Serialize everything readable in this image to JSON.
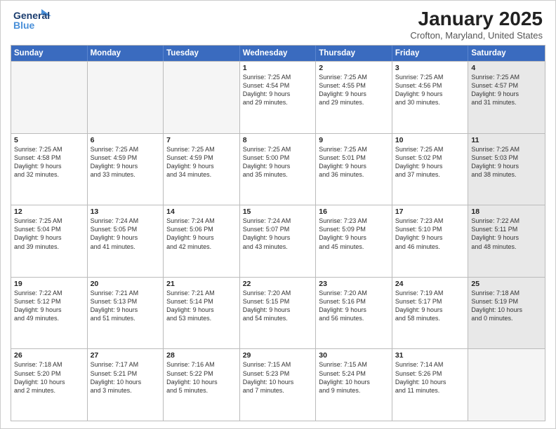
{
  "header": {
    "logo_line1": "General",
    "logo_line2": "Blue",
    "title": "January 2025",
    "subtitle": "Crofton, Maryland, United States"
  },
  "days_of_week": [
    "Sunday",
    "Monday",
    "Tuesday",
    "Wednesday",
    "Thursday",
    "Friday",
    "Saturday"
  ],
  "weeks": [
    [
      {
        "day": "",
        "info": "",
        "empty": true
      },
      {
        "day": "",
        "info": "",
        "empty": true
      },
      {
        "day": "",
        "info": "",
        "empty": true
      },
      {
        "day": "1",
        "info": "Sunrise: 7:25 AM\nSunset: 4:54 PM\nDaylight: 9 hours\nand 29 minutes."
      },
      {
        "day": "2",
        "info": "Sunrise: 7:25 AM\nSunset: 4:55 PM\nDaylight: 9 hours\nand 29 minutes."
      },
      {
        "day": "3",
        "info": "Sunrise: 7:25 AM\nSunset: 4:56 PM\nDaylight: 9 hours\nand 30 minutes."
      },
      {
        "day": "4",
        "info": "Sunrise: 7:25 AM\nSunset: 4:57 PM\nDaylight: 9 hours\nand 31 minutes.",
        "shaded": true
      }
    ],
    [
      {
        "day": "5",
        "info": "Sunrise: 7:25 AM\nSunset: 4:58 PM\nDaylight: 9 hours\nand 32 minutes."
      },
      {
        "day": "6",
        "info": "Sunrise: 7:25 AM\nSunset: 4:59 PM\nDaylight: 9 hours\nand 33 minutes."
      },
      {
        "day": "7",
        "info": "Sunrise: 7:25 AM\nSunset: 4:59 PM\nDaylight: 9 hours\nand 34 minutes."
      },
      {
        "day": "8",
        "info": "Sunrise: 7:25 AM\nSunset: 5:00 PM\nDaylight: 9 hours\nand 35 minutes."
      },
      {
        "day": "9",
        "info": "Sunrise: 7:25 AM\nSunset: 5:01 PM\nDaylight: 9 hours\nand 36 minutes."
      },
      {
        "day": "10",
        "info": "Sunrise: 7:25 AM\nSunset: 5:02 PM\nDaylight: 9 hours\nand 37 minutes."
      },
      {
        "day": "11",
        "info": "Sunrise: 7:25 AM\nSunset: 5:03 PM\nDaylight: 9 hours\nand 38 minutes.",
        "shaded": true
      }
    ],
    [
      {
        "day": "12",
        "info": "Sunrise: 7:25 AM\nSunset: 5:04 PM\nDaylight: 9 hours\nand 39 minutes."
      },
      {
        "day": "13",
        "info": "Sunrise: 7:24 AM\nSunset: 5:05 PM\nDaylight: 9 hours\nand 41 minutes."
      },
      {
        "day": "14",
        "info": "Sunrise: 7:24 AM\nSunset: 5:06 PM\nDaylight: 9 hours\nand 42 minutes."
      },
      {
        "day": "15",
        "info": "Sunrise: 7:24 AM\nSunset: 5:07 PM\nDaylight: 9 hours\nand 43 minutes."
      },
      {
        "day": "16",
        "info": "Sunrise: 7:23 AM\nSunset: 5:09 PM\nDaylight: 9 hours\nand 45 minutes."
      },
      {
        "day": "17",
        "info": "Sunrise: 7:23 AM\nSunset: 5:10 PM\nDaylight: 9 hours\nand 46 minutes."
      },
      {
        "day": "18",
        "info": "Sunrise: 7:22 AM\nSunset: 5:11 PM\nDaylight: 9 hours\nand 48 minutes.",
        "shaded": true
      }
    ],
    [
      {
        "day": "19",
        "info": "Sunrise: 7:22 AM\nSunset: 5:12 PM\nDaylight: 9 hours\nand 49 minutes."
      },
      {
        "day": "20",
        "info": "Sunrise: 7:21 AM\nSunset: 5:13 PM\nDaylight: 9 hours\nand 51 minutes."
      },
      {
        "day": "21",
        "info": "Sunrise: 7:21 AM\nSunset: 5:14 PM\nDaylight: 9 hours\nand 53 minutes."
      },
      {
        "day": "22",
        "info": "Sunrise: 7:20 AM\nSunset: 5:15 PM\nDaylight: 9 hours\nand 54 minutes."
      },
      {
        "day": "23",
        "info": "Sunrise: 7:20 AM\nSunset: 5:16 PM\nDaylight: 9 hours\nand 56 minutes."
      },
      {
        "day": "24",
        "info": "Sunrise: 7:19 AM\nSunset: 5:17 PM\nDaylight: 9 hours\nand 58 minutes."
      },
      {
        "day": "25",
        "info": "Sunrise: 7:18 AM\nSunset: 5:19 PM\nDaylight: 10 hours\nand 0 minutes.",
        "shaded": true
      }
    ],
    [
      {
        "day": "26",
        "info": "Sunrise: 7:18 AM\nSunset: 5:20 PM\nDaylight: 10 hours\nand 2 minutes."
      },
      {
        "day": "27",
        "info": "Sunrise: 7:17 AM\nSunset: 5:21 PM\nDaylight: 10 hours\nand 3 minutes."
      },
      {
        "day": "28",
        "info": "Sunrise: 7:16 AM\nSunset: 5:22 PM\nDaylight: 10 hours\nand 5 minutes."
      },
      {
        "day": "29",
        "info": "Sunrise: 7:15 AM\nSunset: 5:23 PM\nDaylight: 10 hours\nand 7 minutes."
      },
      {
        "day": "30",
        "info": "Sunrise: 7:15 AM\nSunset: 5:24 PM\nDaylight: 10 hours\nand 9 minutes."
      },
      {
        "day": "31",
        "info": "Sunrise: 7:14 AM\nSunset: 5:26 PM\nDaylight: 10 hours\nand 11 minutes."
      },
      {
        "day": "",
        "info": "",
        "empty": true,
        "shaded": true
      }
    ]
  ]
}
